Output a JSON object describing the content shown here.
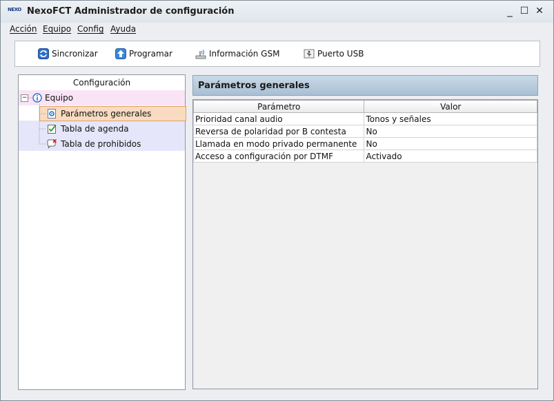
{
  "window": {
    "title": "NexoFCT Administrador de configuración",
    "logo_text": "NEXO",
    "controls": {
      "minimize": "_",
      "maximize": "☐",
      "close": "✕"
    }
  },
  "menu": {
    "items": [
      "Acción",
      "Equipo",
      "Config",
      "Ayuda"
    ]
  },
  "toolbar": {
    "buttons": [
      {
        "label": "Sincronizar",
        "icon": "sync-icon"
      },
      {
        "label": "Programar",
        "icon": "upload-arrow-icon"
      },
      {
        "label": "Información GSM",
        "icon": "gsm-antenna-icon"
      },
      {
        "label": "Puerto USB",
        "icon": "usb-port-icon"
      }
    ]
  },
  "tree": {
    "header": "Configuración",
    "root": {
      "label": "Equipo",
      "expander": "−"
    },
    "children": [
      {
        "label": "Parámetros generales",
        "selected": true
      },
      {
        "label": "Tabla de agenda",
        "selected": false
      },
      {
        "label": "Tabla de prohibidos",
        "selected": false
      }
    ]
  },
  "content": {
    "title": "Parámetros generales",
    "columns": [
      "Parámetro",
      "Valor"
    ],
    "rows": [
      [
        "Prioridad canal audio",
        "Tonos y señales"
      ],
      [
        "Reversa de polaridad por B contesta",
        "No"
      ],
      [
        "Llamada en modo privado permanente",
        "No"
      ],
      [
        "Acceso a configuración por DTMF",
        "Activado"
      ]
    ]
  },
  "colors": {
    "selected_row_bg": "#f8dbc0",
    "section_header_bg": "#b9cde0",
    "root_row_bg": "#f9e4f6",
    "children_row_bg": "#e6e6fa"
  }
}
